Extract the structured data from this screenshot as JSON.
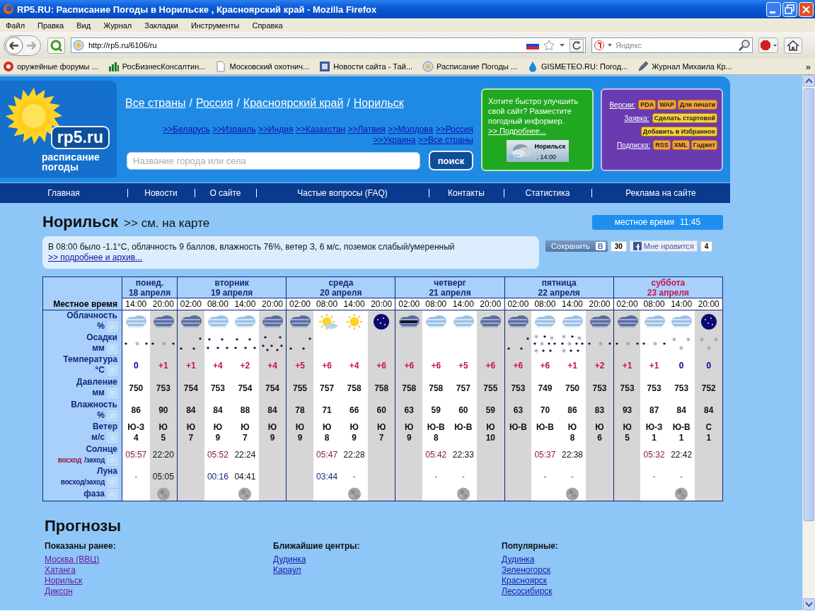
{
  "window": {
    "title": "RP5.RU: Расписание Погоды в Норильске , Красноярский край - Mozilla Firefox"
  },
  "menu": [
    "Файл",
    "Правка",
    "Вид",
    "Журнал",
    "Закладки",
    "Инструменты",
    "Справка"
  ],
  "address": {
    "value": "http://rp5.ru/6106/ru"
  },
  "web_search": {
    "placeholder": "Яндекс"
  },
  "bookmarks": [
    "оружейные форумы ...",
    "РосБизнесКонсалтин...",
    "Московский охотнич...",
    "Новости сайта - Тай...",
    "Расписание Погоды ...",
    "GISMETEO.RU: Погод...",
    "Журнал Михаила Кр..."
  ],
  "bookmarks_more": "»",
  "logo": {
    "title": "rp5.ru",
    "subtitle": "расписание погоды"
  },
  "breadcrumbs": [
    {
      "kind": "link",
      "text": "Все страны"
    },
    {
      "kind": "separator",
      "text": "/"
    },
    {
      "kind": "link",
      "text": "Россия"
    },
    {
      "kind": "separator",
      "text": "/"
    },
    {
      "kind": "link",
      "text": "Красноярский край"
    },
    {
      "kind": "separator",
      "text": "/"
    },
    {
      "kind": "link",
      "text": "Норильск"
    }
  ],
  "countries": [
    ">>Беларусь",
    ">>Израиль",
    ">>Индия",
    ">>Казахстан",
    ">>Латвия",
    ">>Молдова",
    ">>Россия",
    ">>Украина",
    ">>Все страны"
  ],
  "city_search": {
    "placeholder": "Название города или села",
    "button": "поиск"
  },
  "informer": {
    "text": "Хотите быстро улучшить свой сайт? Разместите погодный информер.",
    "link": ">> Подробнее...",
    "city": "Норильск",
    "temp": "0°C",
    "time": ", 14:00"
  },
  "options": [
    {
      "label": "Версии:",
      "buttons": [
        {
          "text": "PDA",
          "color": "#f4a23a"
        },
        {
          "text": "WAP",
          "color": "#f4a23a"
        },
        {
          "text": "Для печати",
          "color": "#f4a23a"
        }
      ]
    },
    {
      "label": "Заявка:",
      "buttons": [
        {
          "text": "Сделать стартовой",
          "color": "#f6d23a"
        }
      ]
    },
    {
      "buttons": [
        {
          "text": "Добавить в Избранное",
          "color": "#f6d23a"
        }
      ]
    },
    {
      "label": "Подписка:",
      "buttons": [
        {
          "text": "RSS",
          "color": "#f4a23a"
        },
        {
          "text": "XML",
          "color": "#f4a23a"
        },
        {
          "text": "Гаджет",
          "color": "#f4a23a"
        }
      ]
    }
  ],
  "nav": [
    "Главная",
    "Новости",
    "О сайте",
    "Частые вопросы (FAQ)",
    "Контакты",
    "Статистика",
    "Реклама на сайте"
  ],
  "city": {
    "name": "Норильск",
    "map_link": ">> см. на карте"
  },
  "local_time": {
    "label": "местное время",
    "value": "11:45"
  },
  "current": {
    "text": "В 08:00 было -1.1°C, облачность 9 баллов, влажность 76%, ветер З, 6 м/с, поземок слабый/умеренный",
    "link": ">> подробнее и архив..."
  },
  "share": {
    "save": "Сохранить",
    "vk": "В",
    "vk_count": "30",
    "like": "Мне нравится",
    "like_count": "4"
  },
  "table": {
    "time_label": "Местное время",
    "rows": [
      {
        "kind": "sky",
        "label": "Облачность",
        "unit": "%"
      },
      {
        "kind": "precip",
        "label": "Осадки",
        "unit": "мм"
      },
      {
        "kind": "temp",
        "label": "Температура",
        "unit": "°C"
      },
      {
        "kind": "pressure",
        "label": "Давление",
        "unit": "мм"
      },
      {
        "kind": "humidity",
        "label": "Влажность",
        "unit": "%"
      },
      {
        "kind": "wind",
        "label": "Ветер",
        "unit": "м/с"
      },
      {
        "kind": "sun",
        "label": "Солнце",
        "legend": [
          {
            "text": "восход",
            "color": "#8b1a4a"
          },
          {
            "text": "/заход",
            "color": "#1a237e"
          }
        ]
      },
      {
        "kind": "moon",
        "label": "Луна",
        "legend": [
          {
            "text": "восход/заход",
            "color": "#1a237e"
          }
        ]
      },
      {
        "kind": "phase",
        "label": "фаза"
      }
    ],
    "days": [
      {
        "name": "понед.",
        "date": "18 апреля",
        "weekend": false,
        "slots": [
          {
            "time": "14:00",
            "night": false,
            "sky": {
              "kind": "clouds"
            },
            "precip": {
              "kind": "mix"
            },
            "temp": {
              "text": "0",
              "color": "#000099"
            },
            "pressure": "750",
            "humidity": "86",
            "wind_dir": "Ю-З",
            "wind_speed": "4",
            "sun": {
              "kind": "rise",
              "text": "05:57"
            },
            "moon": {
              "kind": "none",
              "text": "-"
            }
          },
          {
            "time": "20:00",
            "night": true,
            "sky": {
              "kind": "clouds_dark"
            },
            "precip": {
              "kind": "mix"
            },
            "temp": {
              "text": "+1",
              "color": "#cc1144"
            },
            "pressure": "753",
            "humidity": "90",
            "wind_dir": "Ю",
            "wind_speed": "5",
            "sun": {
              "kind": "set",
              "text": "22:20"
            },
            "moon": {
              "kind": "set",
              "text": "05:05"
            },
            "phase": true
          }
        ]
      },
      {
        "name": "вторник",
        "date": "19 апреля",
        "weekend": false,
        "slots": [
          {
            "time": "02:00",
            "night": true,
            "sky": {
              "kind": "clouds_dark"
            },
            "precip": {
              "kind": "rain_light"
            },
            "temp": {
              "text": "+1",
              "color": "#cc1144"
            },
            "pressure": "754",
            "humidity": "84",
            "wind_dir": "Ю",
            "wind_speed": "7"
          },
          {
            "time": "08:00",
            "night": false,
            "sky": {
              "kind": "clouds"
            },
            "precip": {
              "kind": "rain"
            },
            "temp": {
              "text": "+4",
              "color": "#cc1144"
            },
            "pressure": "753",
            "humidity": "84",
            "wind_dir": "Ю",
            "wind_speed": "9",
            "sun": {
              "kind": "rise",
              "text": "05:52"
            },
            "moon": {
              "kind": "rise",
              "text": "00:16"
            }
          },
          {
            "time": "14:00",
            "night": false,
            "sky": {
              "kind": "clouds"
            },
            "precip": {
              "kind": "rain"
            },
            "temp": {
              "text": "+2",
              "color": "#cc1144"
            },
            "pressure": "754",
            "humidity": "88",
            "wind_dir": "Ю",
            "wind_speed": "7",
            "sun": {
              "kind": "set",
              "text": "22:24"
            },
            "moon": {
              "kind": "set",
              "text": "04:41"
            },
            "phase": true
          },
          {
            "time": "20:00",
            "night": true,
            "sky": {
              "kind": "clouds_dark"
            },
            "precip": {
              "kind": "rain_heavy"
            },
            "temp": {
              "text": "+4",
              "color": "#cc1144"
            },
            "pressure": "754",
            "humidity": "84",
            "wind_dir": "Ю",
            "wind_speed": "9"
          }
        ]
      },
      {
        "name": "среда",
        "date": "20 апреля",
        "weekend": false,
        "slots": [
          {
            "time": "02:00",
            "night": true,
            "sky": {
              "kind": "clouds_dark"
            },
            "precip": {
              "kind": "rain_light"
            },
            "temp": {
              "text": "+5",
              "color": "#cc1144"
            },
            "pressure": "755",
            "humidity": "78",
            "wind_dir": "Ю",
            "wind_speed": "9"
          },
          {
            "time": "08:00",
            "night": false,
            "sky": {
              "kind": "sun_cloud"
            },
            "precip": {
              "kind": "none"
            },
            "temp": {
              "text": "+6",
              "color": "#cc1144"
            },
            "pressure": "757",
            "humidity": "71",
            "wind_dir": "Ю",
            "wind_speed": "8",
            "sun": {
              "kind": "rise",
              "text": "05:47"
            },
            "moon": {
              "kind": "rise",
              "text": "03:44"
            }
          },
          {
            "time": "14:00",
            "night": false,
            "sky": {
              "kind": "sun"
            },
            "precip": {
              "kind": "none"
            },
            "temp": {
              "text": "+4",
              "color": "#cc1144"
            },
            "pressure": "758",
            "humidity": "66",
            "wind_dir": "Ю",
            "wind_speed": "9",
            "sun": {
              "kind": "set",
              "text": "22:28"
            },
            "moon": {
              "kind": "none",
              "text": "-"
            },
            "phase": true
          },
          {
            "time": "20:00",
            "night": true,
            "sky": {
              "kind": "night_clear"
            },
            "precip": {
              "kind": "none"
            },
            "temp": {
              "text": "+6",
              "color": "#cc1144"
            },
            "pressure": "758",
            "humidity": "60",
            "wind_dir": "Ю",
            "wind_speed": "7"
          }
        ]
      },
      {
        "name": "четверг",
        "date": "21 апреля",
        "weekend": false,
        "slots": [
          {
            "time": "02:00",
            "night": true,
            "sky": {
              "kind": "clouds_band"
            },
            "precip": {
              "kind": "none"
            },
            "temp": {
              "text": "+6",
              "color": "#cc1144"
            },
            "pressure": "758",
            "humidity": "63",
            "wind_dir": "Ю",
            "wind_speed": "9"
          },
          {
            "time": "08:00",
            "night": false,
            "sky": {
              "kind": "clouds"
            },
            "precip": {
              "kind": "none"
            },
            "temp": {
              "text": "+6",
              "color": "#cc1144"
            },
            "pressure": "758",
            "humidity": "59",
            "wind_dir": "Ю-В",
            "wind_speed": "8",
            "sun": {
              "kind": "rise",
              "text": "05:42"
            },
            "moon": {
              "kind": "none",
              "text": "-"
            }
          },
          {
            "time": "14:00",
            "night": false,
            "sky": {
              "kind": "clouds"
            },
            "precip": {
              "kind": "none"
            },
            "temp": {
              "text": "+5",
              "color": "#cc1144"
            },
            "pressure": "757",
            "humidity": "60",
            "wind_dir": "Ю-В",
            "sun": {
              "kind": "set",
              "text": "22:33"
            },
            "moon": {
              "kind": "none",
              "text": "-"
            },
            "phase": true
          },
          {
            "time": "20:00",
            "night": true,
            "sky": {
              "kind": "clouds_dark"
            },
            "precip": {
              "kind": "none"
            },
            "temp": {
              "text": "+6",
              "color": "#cc1144"
            },
            "pressure": "755",
            "humidity": "59",
            "wind_dir": "Ю",
            "wind_speed": "10"
          }
        ]
      },
      {
        "name": "пятница",
        "date": "22 апреля",
        "weekend": false,
        "slots": [
          {
            "time": "02:00",
            "night": true,
            "sky": {
              "kind": "clouds_dark"
            },
            "precip": {
              "kind": "rain_light"
            },
            "temp": {
              "text": "+6",
              "color": "#cc1144"
            },
            "pressure": "753",
            "humidity": "63",
            "wind_dir": "Ю-В"
          },
          {
            "time": "08:00",
            "night": false,
            "sky": {
              "kind": "clouds"
            },
            "precip": {
              "kind": "mix_heavy"
            },
            "temp": {
              "text": "+6",
              "color": "#cc1144"
            },
            "pressure": "749",
            "humidity": "70",
            "wind_dir": "Ю-В",
            "sun": {
              "kind": "rise",
              "text": "05:37"
            },
            "moon": {
              "kind": "none",
              "text": "-"
            }
          },
          {
            "time": "14:00",
            "night": false,
            "sky": {
              "kind": "clouds"
            },
            "precip": {
              "kind": "mix_heavy"
            },
            "temp": {
              "text": "+1",
              "color": "#cc1144"
            },
            "pressure": "750",
            "humidity": "86",
            "wind_dir": "Ю",
            "wind_speed": "8",
            "sun": {
              "kind": "set",
              "text": "22:38"
            },
            "moon": {
              "kind": "none",
              "text": "-"
            },
            "phase": true
          },
          {
            "time": "20:00",
            "night": true,
            "sky": {
              "kind": "clouds_dark"
            },
            "precip": {
              "kind": "mix"
            },
            "temp": {
              "text": "+2",
              "color": "#cc1144"
            },
            "pressure": "753",
            "humidity": "83",
            "wind_dir": "Ю",
            "wind_speed": "6"
          }
        ]
      },
      {
        "name": "суббота",
        "date": "23 апреля",
        "weekend": true,
        "slots": [
          {
            "time": "02:00",
            "night": true,
            "sky": {
              "kind": "clouds_dark"
            },
            "precip": {
              "kind": "mix"
            },
            "temp": {
              "text": "+1",
              "color": "#cc1144"
            },
            "pressure": "753",
            "humidity": "93",
            "wind_dir": "Ю",
            "wind_speed": "5"
          },
          {
            "time": "08:00",
            "night": false,
            "sky": {
              "kind": "clouds"
            },
            "precip": {
              "kind": "mix"
            },
            "temp": {
              "text": "+1",
              "color": "#cc1144"
            },
            "pressure": "753",
            "humidity": "87",
            "wind_dir": "Ю-З",
            "wind_speed": "1",
            "sun": {
              "kind": "rise",
              "text": "05:32"
            },
            "moon": {
              "kind": "none",
              "text": "-"
            }
          },
          {
            "time": "14:00",
            "night": false,
            "sky": {
              "kind": "clouds"
            },
            "precip": {
              "kind": "snow_light"
            },
            "temp": {
              "text": "0",
              "color": "#000099"
            },
            "pressure": "753",
            "humidity": "84",
            "wind_dir": "Ю-В",
            "wind_speed": "1",
            "sun": {
              "kind": "set",
              "text": "22:42"
            },
            "moon": {
              "kind": "none",
              "text": "-"
            },
            "phase": true
          },
          {
            "time": "20:00",
            "night": true,
            "sky": {
              "kind": "night_clear"
            },
            "precip": {
              "kind": "snow_light"
            },
            "temp": {
              "text": "0",
              "color": "#000099"
            },
            "pressure": "752",
            "humidity": "84",
            "wind_dir": "С",
            "wind_speed": "1"
          }
        ]
      }
    ]
  },
  "forecasts": {
    "title": "Прогнозы",
    "columns": [
      {
        "title": "Показаны ранее:",
        "links": [
          {
            "text": "Москва (ВВЦ)",
            "visited": true
          },
          {
            "text": "Хатанга",
            "visited": true
          },
          {
            "text": "Норильск",
            "visited": true
          },
          {
            "text": "Диксон",
            "visited": true
          }
        ]
      },
      {
        "title": "Ближайшие центры:",
        "links": [
          {
            "text": "Дудинка",
            "visited": false
          },
          {
            "text": "Караул",
            "visited": false
          }
        ]
      },
      {
        "title": "Популярные:",
        "links": [
          {
            "text": "Дудинка",
            "visited": false
          },
          {
            "text": "Зеленогорск",
            "visited": false
          },
          {
            "text": "Красноярск",
            "visited": false
          },
          {
            "text": "Лесосибирск",
            "visited": false
          }
        ]
      }
    ]
  }
}
